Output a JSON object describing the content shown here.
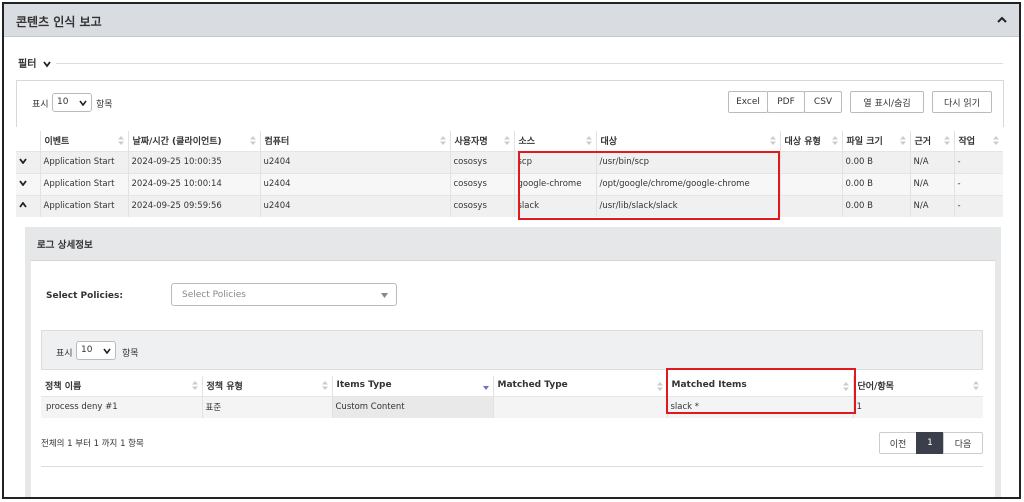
{
  "panel": {
    "title": "콘텐츠 인식 보고"
  },
  "filter": {
    "label": "필터"
  },
  "toolbar": {
    "show_prefix": "표시",
    "page_size": "10",
    "show_suffix": "항목",
    "excel": "Excel",
    "pdf": "PDF",
    "csv": "CSV",
    "columns": "열 표시/숨김",
    "reload": "다시 읽기"
  },
  "main_table": {
    "columns": [
      "이벤트",
      "날짜/시간 (클라이언트)",
      "컴퓨터",
      "사용자명",
      "소스",
      "대상",
      "대상 유형",
      "파일 크기",
      "근거",
      "작업"
    ],
    "rows": [
      {
        "event": "Application Start",
        "datetime": "2024-09-25 10:00:35",
        "computer": "u2404",
        "user": "cososys",
        "source": "scp",
        "target": "/usr/bin/scp",
        "target_type": "",
        "size": "0.00 B",
        "reason": "N/A",
        "action": "-"
      },
      {
        "event": "Application Start",
        "datetime": "2024-09-25 10:00:14",
        "computer": "u2404",
        "user": "cososys",
        "source": "google-chrome",
        "target": "/opt/google/chrome/google-chrome",
        "target_type": "",
        "size": "0.00 B",
        "reason": "N/A",
        "action": "-"
      },
      {
        "event": "Application Start",
        "datetime": "2024-09-25 09:59:56",
        "computer": "u2404",
        "user": "cososys",
        "source": "slack",
        "target": "/usr/lib/slack/slack",
        "target_type": "",
        "size": "0.00 B",
        "reason": "N/A",
        "action": "-"
      }
    ]
  },
  "details": {
    "title": "로그 상세정보",
    "policies_label": "Select Policies:",
    "policies_placeholder": "Select Policies",
    "show_prefix": "표시",
    "page_size": "10",
    "show_suffix": "항목",
    "columns": [
      "정책 이름",
      "정책 유형",
      "Items Type",
      "Matched Type",
      "Matched Items",
      "단어/항목"
    ],
    "rows": [
      {
        "policy_name": "process deny #1",
        "policy_type": "표준",
        "items_type": "Custom Content",
        "matched_type": "",
        "matched_items": "slack *",
        "words": "1"
      }
    ],
    "summary": "전체의 1 부터 1 까지 1 항목",
    "pager": {
      "prev": "이전",
      "page": "1",
      "next": "다음"
    }
  },
  "colors": {
    "highlight": "#e0191f",
    "header_bg": "#d9dde2",
    "active_page": "#3a3f4b"
  }
}
